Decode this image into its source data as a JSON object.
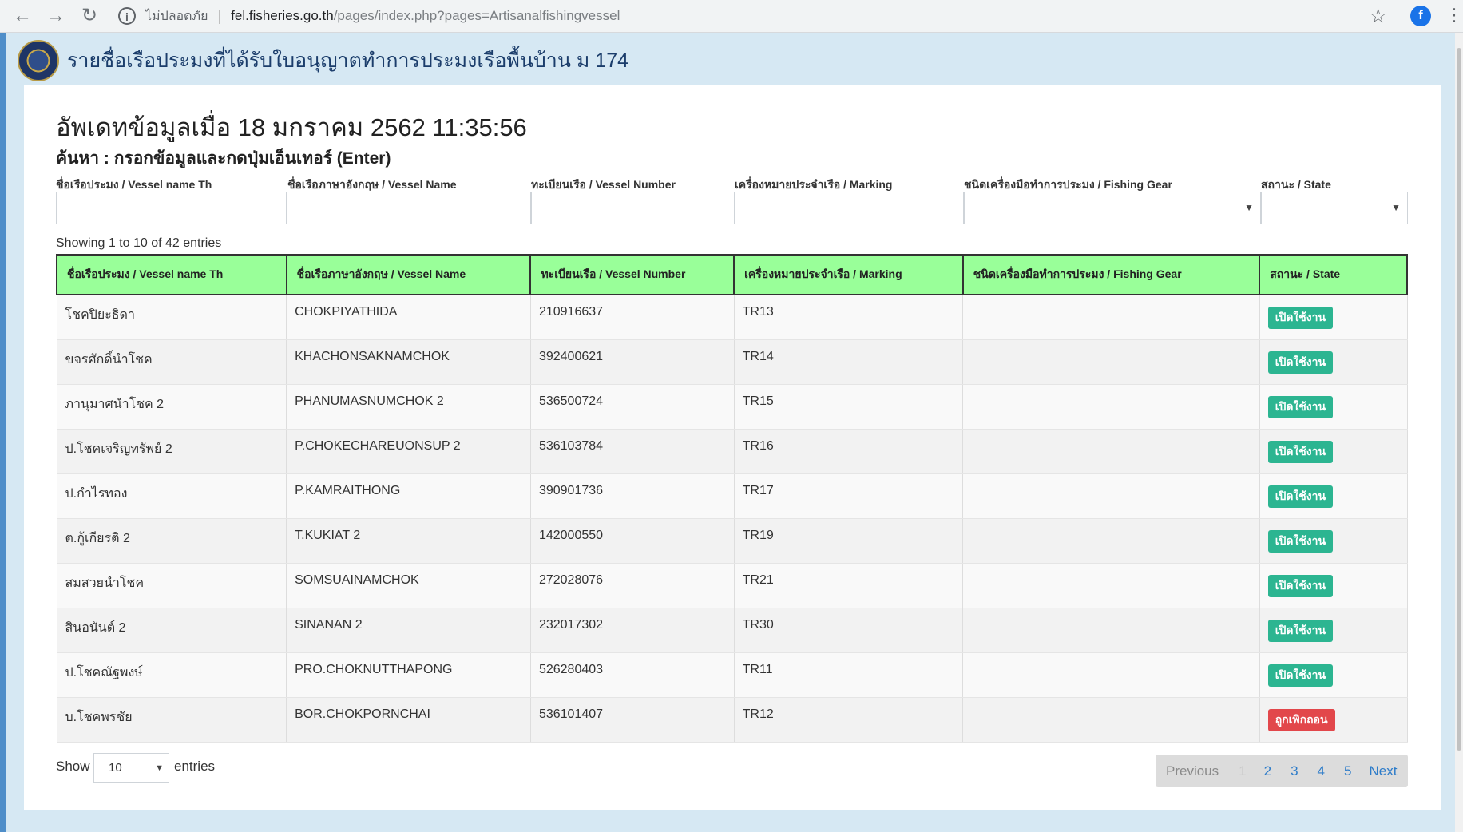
{
  "browser": {
    "insecure_label": "ไม่ปลอดภัย",
    "url_host": "fel.fisheries.go.th",
    "url_path": "/pages/index.php?pages=Artisanalfishingvessel",
    "profile_initial": "f"
  },
  "site": {
    "title": "รายชื่อเรือประมงที่ได้รับใบอนุญาตทำการประมงเรือพื้นบ้าน ม 174"
  },
  "main": {
    "update_title": "อัพเดทข้อมูลเมื่อ 18 มกราคม 2562 11:35:56",
    "search_hint": "ค้นหา : กรอกข้อมูลและกดปุ่มเอ็นเทอร์ (Enter)",
    "showing": "Showing 1 to 10 of 42 entries"
  },
  "filters": [
    {
      "label": "ชื่อเรือประมง / Vessel name Th"
    },
    {
      "label": "ชื่อเรือภาษาอังกฤษ / Vessel Name"
    },
    {
      "label": "ทะเบียนเรือ / Vessel Number"
    },
    {
      "label": "เครื่องหมายประจำเรือ / Marking"
    },
    {
      "label": "ชนิดเครื่องมือทำการประมง / Fishing Gear"
    },
    {
      "label": "สถานะ / State"
    }
  ],
  "table": {
    "columns": [
      "ชื่อเรือประมง / Vessel name Th",
      "ชื่อเรือภาษาอังกฤษ / Vessel Name",
      "ทะเบียนเรือ / Vessel Number",
      "เครื่องหมายประจำเรือ / Marking",
      "ชนิดเครื่องมือทำการประมง / Fishing Gear",
      "สถานะ / State"
    ],
    "rows": [
      {
        "th": "โชคปิยะธิดา",
        "en": "CHOKPIYATHIDA",
        "number": "210916637",
        "marking": "TR13",
        "gear": "",
        "state": "เปิดใช้งาน",
        "state_color": "#2cb591"
      },
      {
        "th": "ขจรศักดิ์นำโชค",
        "en": "KHACHONSAKNAMCHOK",
        "number": "392400621",
        "marking": "TR14",
        "gear": "",
        "state": "เปิดใช้งาน",
        "state_color": "#2cb591"
      },
      {
        "th": "ภานุมาศนำโชค 2",
        "en": "PHANUMASNUMCHOK 2",
        "number": "536500724",
        "marking": "TR15",
        "gear": "",
        "state": "เปิดใช้งาน",
        "state_color": "#2cb591"
      },
      {
        "th": "ป.โชคเจริญทรัพย์ 2",
        "en": "P.CHOKECHAREUONSUP 2",
        "number": "536103784",
        "marking": "TR16",
        "gear": "",
        "state": "เปิดใช้งาน",
        "state_color": "#2cb591"
      },
      {
        "th": "ป.กำไรทอง",
        "en": "P.KAMRAITHONG",
        "number": "390901736",
        "marking": "TR17",
        "gear": "",
        "state": "เปิดใช้งาน",
        "state_color": "#2cb591"
      },
      {
        "th": "ต.กู้เกียรติ 2",
        "en": "T.KUKIAT 2",
        "number": "142000550",
        "marking": "TR19",
        "gear": "",
        "state": "เปิดใช้งาน",
        "state_color": "#2cb591"
      },
      {
        "th": "สมสวยนำโชค",
        "en": "SOMSUAINAMCHOK",
        "number": "272028076",
        "marking": "TR21",
        "gear": "",
        "state": "เปิดใช้งาน",
        "state_color": "#2cb591"
      },
      {
        "th": "สินอนันต์ 2",
        "en": "SINANAN 2",
        "number": "232017302",
        "marking": "TR30",
        "gear": "",
        "state": "เปิดใช้งาน",
        "state_color": "#2cb591"
      },
      {
        "th": "ป.โชคณัฐพงษ์",
        "en": "PRO.CHOKNUTTHAPONG",
        "number": "526280403",
        "marking": "TR11",
        "gear": "",
        "state": "เปิดใช้งาน",
        "state_color": "#2cb591"
      },
      {
        "th": "บ.โชคพรชัย",
        "en": "BOR.CHOKPORNCHAI",
        "number": "536101407",
        "marking": "TR12",
        "gear": "",
        "state": "ถูกเพิกถอน",
        "state_color": "#e2474b"
      }
    ]
  },
  "length_menu": {
    "show_label": "Show",
    "selected": "10",
    "entries_label": "entries"
  },
  "pagination": {
    "previous": "Previous",
    "pages": [
      "1",
      "2",
      "3",
      "4",
      "5"
    ],
    "next": "Next"
  }
}
